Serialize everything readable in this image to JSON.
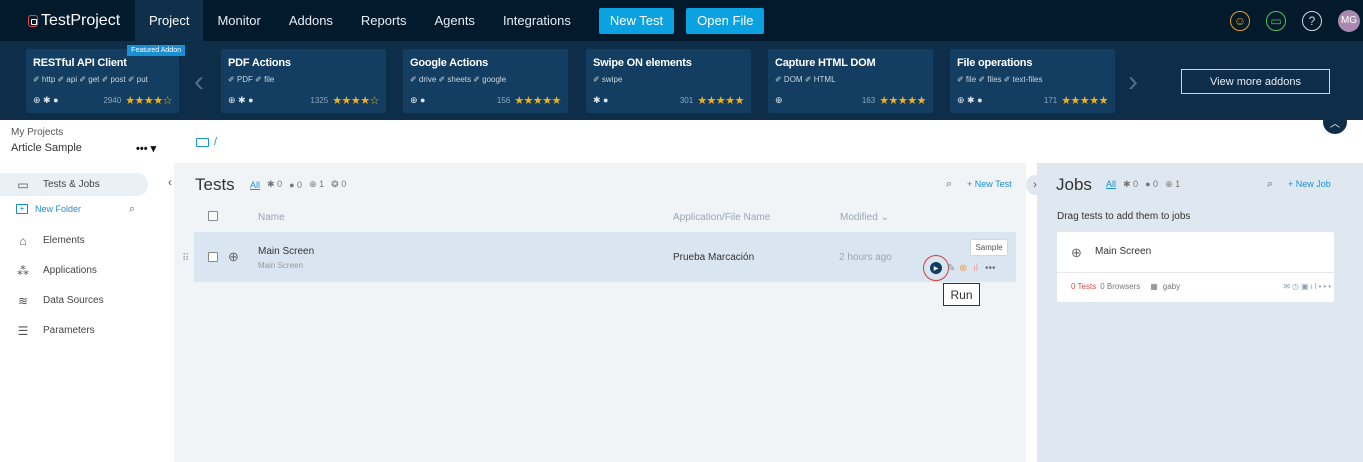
{
  "nav": {
    "brand": "TestProject",
    "items": [
      "Project",
      "Monitor",
      "Addons",
      "Reports",
      "Agents",
      "Integrations"
    ],
    "new_test": "New Test",
    "open_file": "Open File",
    "avatar": "MG",
    "help": "?"
  },
  "addons": {
    "featured_label": "Featured Addon",
    "view_more": "View more addons",
    "cards": [
      {
        "title": "RESTful API Client",
        "tags": "✐ http  ✐ api  ✐ get  ✐ post  ✐ put",
        "platforms": "⊕ ✱ ●",
        "count": "2940",
        "stars": "★★★★☆"
      },
      {
        "title": "PDF Actions",
        "tags": "✐ PDF  ✐ file",
        "platforms": "⊕ ✱ ●",
        "count": "1325",
        "stars": "★★★★☆"
      },
      {
        "title": "Google Actions",
        "tags": "✐ drive  ✐ sheets  ✐ google",
        "platforms": "⊕ ●",
        "count": "156",
        "stars": "★★★★★"
      },
      {
        "title": "Swipe ON elements",
        "tags": "✐ swipe",
        "platforms": "✱ ●",
        "count": "301",
        "stars": "★★★★★"
      },
      {
        "title": "Capture HTML DOM",
        "tags": "✐ DOM  ✐ HTML",
        "platforms": "⊕",
        "count": "163",
        "stars": "★★★★★"
      },
      {
        "title": "File operations",
        "tags": "✐ file  ✐ files  ✐ text-files",
        "platforms": "⊕ ✱ ●",
        "count": "171",
        "stars": "★★★★★"
      }
    ]
  },
  "sidebar": {
    "label": "My Projects",
    "project": "Article Sample",
    "menu_dots": "•••",
    "new_folder": "New Folder",
    "items": [
      "Tests & Jobs",
      "Elements",
      "Applications",
      "Data Sources",
      "Parameters"
    ]
  },
  "breadcrumb": "/",
  "tests": {
    "title": "Tests",
    "filter_all": "All",
    "filters": [
      "0",
      "0",
      "1",
      "0"
    ],
    "new_test": "+ New Test",
    "columns": [
      "Name",
      "Application/File Name",
      "Modified"
    ],
    "row": {
      "name": "Main Screen",
      "sub": "Main Screen",
      "app": "Prueba Marcación",
      "modified": "2 hours ago"
    },
    "tooltip_run": "Run",
    "tooltip_sample": "Sample"
  },
  "jobs": {
    "title": "Jobs",
    "filter_all": "All",
    "filters": [
      "0",
      "0",
      "1"
    ],
    "new_job": "+ New Job",
    "hint": "Drag tests to add them to jobs",
    "card": {
      "name": "Main Screen",
      "tests": "0 Tests",
      "browsers": "0 Browsers",
      "owner": "gaby"
    }
  }
}
